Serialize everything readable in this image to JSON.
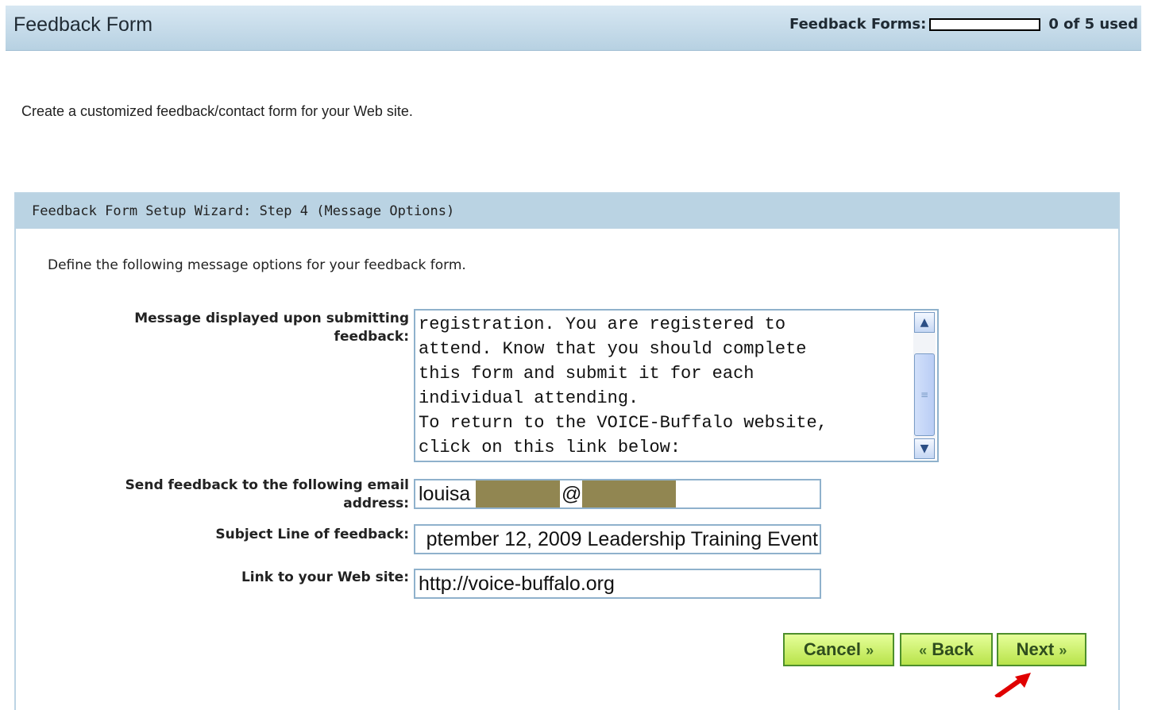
{
  "header": {
    "title": "Feedback Form",
    "usage_label": "Feedback Forms:",
    "usage_text": "0 of 5 used",
    "usage_fraction": 0
  },
  "intro": "Create a customized feedback/contact form for your Web site.",
  "wizard": {
    "title": "Feedback Form Setup Wizard: Step 4  (Message Options)",
    "description": "Define the following message options for your feedback form.",
    "message": {
      "label_line1": "Message displayed upon submitting",
      "label_line2": "feedback:",
      "value": "registration. You are registered to\nattend. Know that you should complete\nthis form and submit it for each\nindividual attending.\nTo return to the VOICE-Buffalo website,\nclick on this link below:"
    },
    "email": {
      "label_line1": "Send feedback to the following email",
      "label_line2": "address:",
      "value_prefix": "louisa",
      "value_at": "@"
    },
    "subject": {
      "label": "Subject Line of feedback:",
      "value": "ptember 12, 2009 Leadership Training Event"
    },
    "website": {
      "label": "Link to your Web site:",
      "value": "http://voice-buffalo.org"
    },
    "buttons": {
      "cancel": "Cancel",
      "back": "Back",
      "next": "Next"
    }
  },
  "colors": {
    "header_bg": "#b7d1e2",
    "wizard_head_bg": "#bad3e3",
    "button_bg": "#c8f05a",
    "redaction": "#918651",
    "annotation_arrow": "#e00000"
  }
}
